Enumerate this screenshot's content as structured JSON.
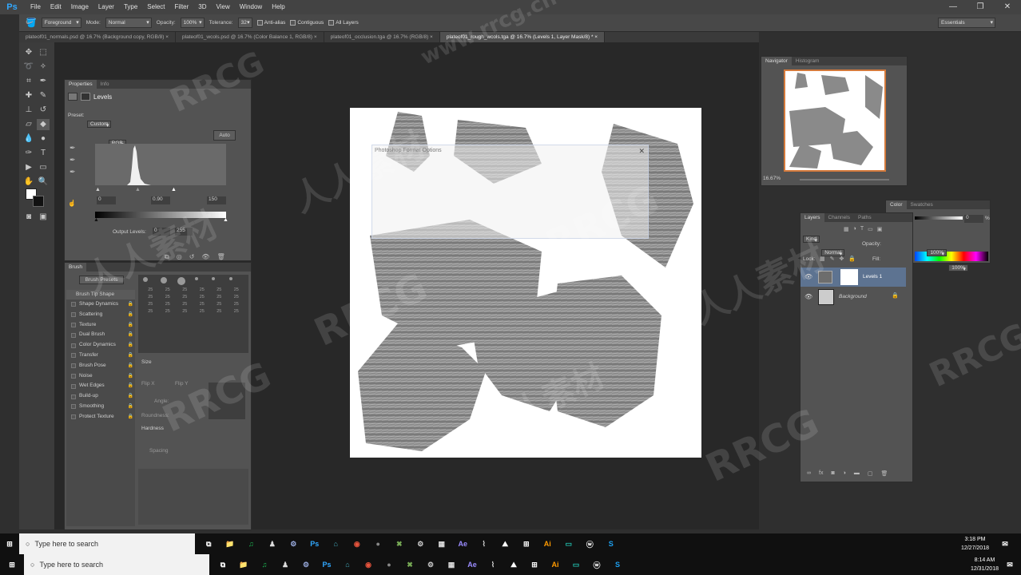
{
  "app": {
    "logo": "Ps"
  },
  "menu": [
    "File",
    "Edit",
    "Image",
    "Layer",
    "Type",
    "Select",
    "Filter",
    "3D",
    "View",
    "Window",
    "Help"
  ],
  "window_controls": {
    "min": "—",
    "max": "❐",
    "close": "✕"
  },
  "options": {
    "sample": "Foreground",
    "mode_label": "Mode:",
    "mode": "Normal",
    "opacity_label": "Opacity:",
    "opacity": "100%",
    "tolerance_label": "Tolerance:",
    "tolerance": "32",
    "antialias": "Anti-alias",
    "contiguous": "Contiguous",
    "all_layers": "All Layers",
    "workspace": "Essentials"
  },
  "doc_tabs": [
    "plateof01_normals.psd @ 16.7% (Background copy, RGB/8) ×",
    "plateof01_wcols.psd @ 16.7% (Color Balance 1, RGB/8) ×",
    "plateof01_occlusion.tga @ 16.7% (RGB/8) ×",
    "plateof01_rough_wcols.tga @ 16.7% (Levels 1, Layer Mask/8) * ×"
  ],
  "properties": {
    "tabs": [
      "Properties",
      "Info"
    ],
    "title": "Levels",
    "preset_label": "Preset:",
    "preset": "Custom",
    "channel": "RGB",
    "auto": "Auto",
    "input_black": "0",
    "input_gamma": "0.90",
    "input_white": "150",
    "output_label": "Output Levels:",
    "output_black": "0",
    "output_white": "255"
  },
  "brush": {
    "tab": "Brush",
    "presets_button": "Brush Presets",
    "tip_shape": "Brush Tip Shape",
    "options": [
      "Shape Dynamics",
      "Scattering",
      "Texture",
      "Dual Brush",
      "Color Dynamics",
      "Transfer",
      "Brush Pose",
      "Noise",
      "Wet Edges",
      "Build-up",
      "Smoothing",
      "Protect Texture"
    ],
    "sizes": [
      "25",
      "25",
      "25",
      "25",
      "25",
      "25",
      "25",
      "25",
      "25",
      "25",
      "25",
      "25",
      "25",
      "25",
      "25",
      "25",
      "25",
      "25",
      "25",
      "25",
      "25",
      "25",
      "25",
      "25"
    ],
    "size_label": "Size",
    "flipx": "Flip X",
    "flipy": "Flip Y",
    "angle": "Angle:",
    "roundness": "Roundness:",
    "hardness": "Hardness",
    "spacing": "Spacing"
  },
  "navigator": {
    "tabs": [
      "Navigator",
      "Histogram"
    ],
    "zoom": "16.67%"
  },
  "color_panel": {
    "tabs": [
      "Color",
      "Swatches"
    ],
    "value": "0",
    "unit": "%"
  },
  "layers": {
    "tabs": [
      "Layers",
      "Channels",
      "Paths"
    ],
    "filter": "Kind",
    "blend": "Normal",
    "opacity_label": "Opacity:",
    "opacity": "100%",
    "lock_label": "Lock:",
    "fill_label": "Fill:",
    "fill": "100%",
    "items": [
      {
        "name": "Levels 1"
      },
      {
        "name": "Background"
      }
    ]
  },
  "dialog": {
    "title": "Photoshop Format Options",
    "close": "✕"
  },
  "taskbars": [
    {
      "search": "Type here to search",
      "time": "3:18 PM",
      "date": "12/27/2018"
    },
    {
      "search": "Type here to search",
      "time": "8:14 AM",
      "date": "12/31/2018"
    }
  ],
  "taskbar_apps": [
    "⧉",
    "📁",
    "♫",
    "♟",
    "⚙",
    "Ps",
    "⌂",
    "◉",
    "●",
    "✖",
    "⚙",
    "▦",
    "Ae",
    "⌇",
    "⛰",
    "⊞",
    "Ai",
    "▭",
    "ⓦ",
    "S"
  ],
  "watermarks": [
    "RRCG",
    "人人素材",
    "www.rrcg.cn"
  ]
}
